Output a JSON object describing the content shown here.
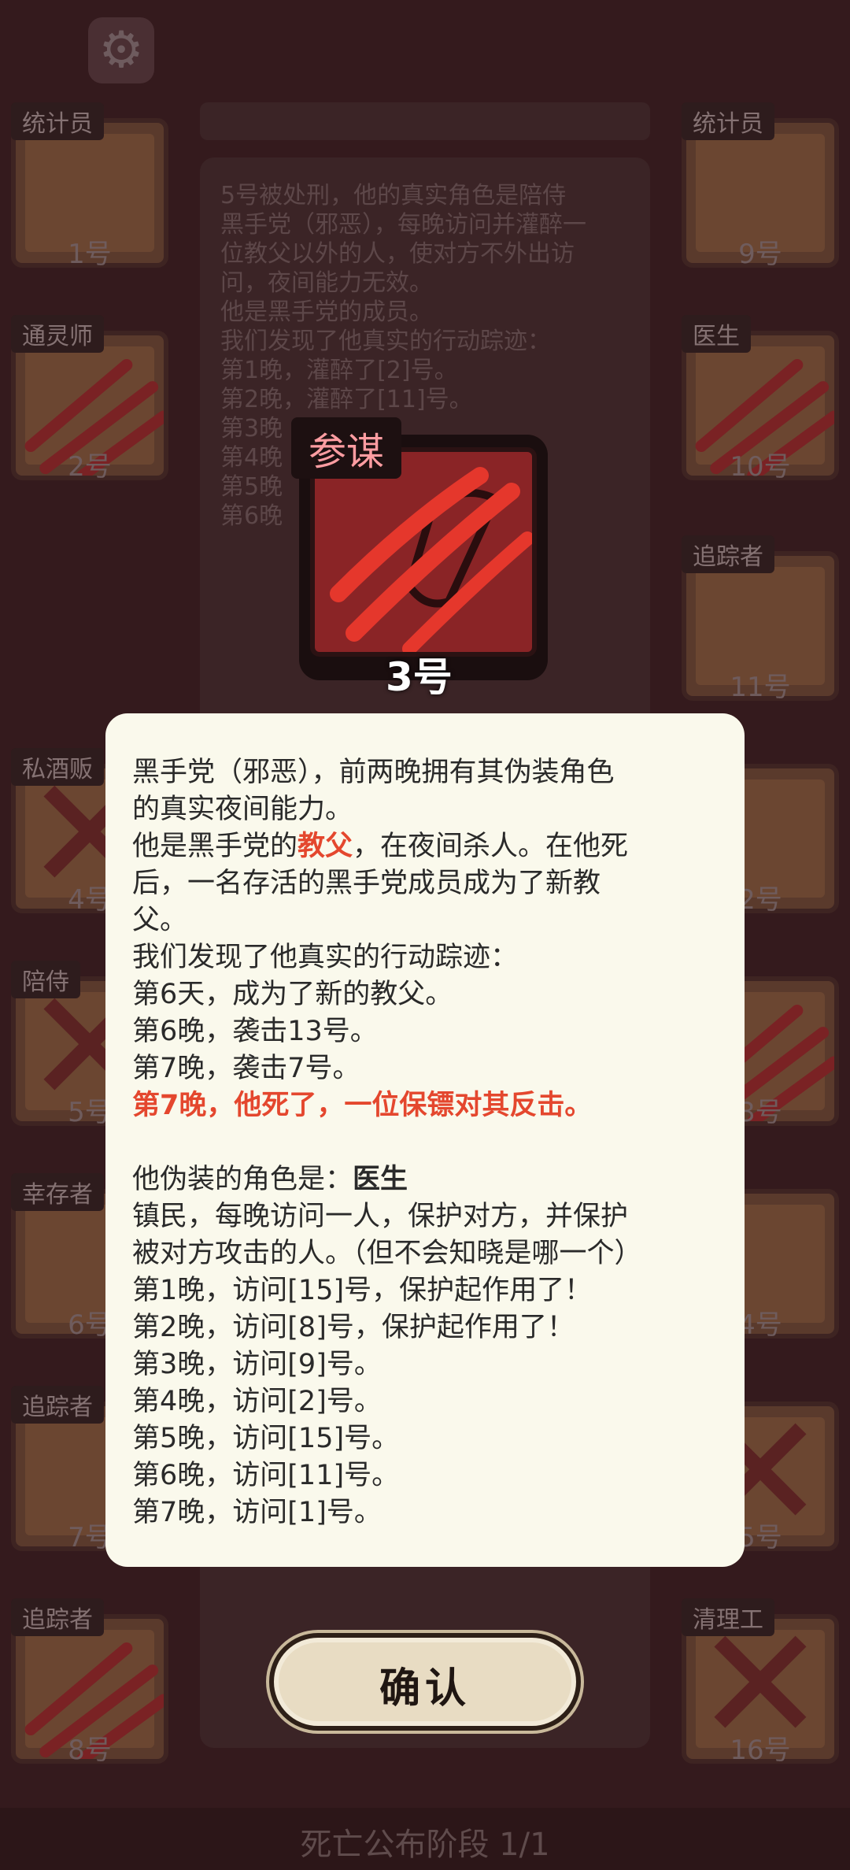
{
  "background": {
    "log_lines": [
      "5号被处刑，他的真实角色是陪侍",
      "黑手党（邪恶），每晚访问并灌醉一",
      "位教父以外的人，使对方不外出访",
      "问，夜间能力无效。",
      "他是黑手党的成员。",
      "我们发现了他真实的行动踪迹：",
      "第1晚，灌醉了[2]号。",
      "第2晚，灌醉了[11]号。",
      "第3晚",
      "第4晚",
      "第5晚",
      "第6晚"
    ],
    "phase_label": "死亡公布阶段 1/1"
  },
  "players": [
    {
      "role": "统计员",
      "number": "1号",
      "status": "alive"
    },
    {
      "role": "通灵师",
      "number": "2号",
      "status": "dead"
    },
    {
      "role": "私酒贩",
      "number": "4号",
      "status": "executed"
    },
    {
      "role": "陪侍",
      "number": "5号",
      "status": "executed"
    },
    {
      "role": "幸存者",
      "number": "6号",
      "status": "alive"
    },
    {
      "role": "追踪者",
      "number": "7号",
      "status": "alive"
    },
    {
      "role": "追踪者",
      "number": "8号",
      "status": "dead"
    },
    {
      "role": "统计员",
      "number": "9号",
      "status": "alive"
    },
    {
      "role": "医生",
      "number": "10号",
      "status": "dead"
    },
    {
      "role": "追踪者",
      "number": "11号",
      "status": "alive"
    },
    {
      "role": "",
      "number": "2号",
      "status": "alive"
    },
    {
      "role": "者",
      "number": "3号",
      "status": "dead"
    },
    {
      "role": "",
      "number": "4号",
      "status": "alive"
    },
    {
      "role": "贩",
      "number": "5号",
      "status": "executed"
    },
    {
      "role": "清理工",
      "number": "16号",
      "status": "executed"
    }
  ],
  "reveal": {
    "role_name": "参谋",
    "player_number": "3号",
    "paragraphs": [
      [
        {
          "t": "黑手党（邪恶），前两晚拥有其伪装角色",
          "s": ""
        }
      ],
      [
        {
          "t": "的真实夜间能力。",
          "s": ""
        }
      ],
      [
        {
          "t": "他是黑手党的",
          "s": ""
        },
        {
          "t": "教父",
          "s": "red"
        },
        {
          "t": "，在夜间杀人。在他死",
          "s": ""
        }
      ],
      [
        {
          "t": "后，一名存活的黑手党成员成为了新教",
          "s": ""
        }
      ],
      [
        {
          "t": "父。",
          "s": ""
        }
      ],
      [
        {
          "t": "我们发现了他真实的行动踪迹：",
          "s": ""
        }
      ],
      [
        {
          "t": "第6天，成为了新的教父。",
          "s": ""
        }
      ],
      [
        {
          "t": "第6晚，袭击13号。",
          "s": ""
        }
      ],
      [
        {
          "t": "第7晚，袭击7号。",
          "s": ""
        }
      ],
      [
        {
          "t": "第7晚，他死了，一位保镖对其反击。",
          "s": "red"
        }
      ],
      [
        {
          "t": "",
          "s": ""
        }
      ],
      [
        {
          "t": "他伪装的角色是：",
          "s": ""
        },
        {
          "t": "医生",
          "s": "bold"
        }
      ],
      [
        {
          "t": "镇民，每晚访问一人，保护对方，并保护",
          "s": ""
        }
      ],
      [
        {
          "t": "被对方攻击的人。（但不会知晓是哪一个）",
          "s": ""
        }
      ],
      [
        {
          "t": "第1晚，访问[15]号，保护起作用了！",
          "s": ""
        }
      ],
      [
        {
          "t": "第2晚，访问[8]号，保护起作用了！",
          "s": ""
        }
      ],
      [
        {
          "t": "第3晚，访问[9]号。",
          "s": ""
        }
      ],
      [
        {
          "t": "第4晚，访问[2]号。",
          "s": ""
        }
      ],
      [
        {
          "t": "第5晚，访问[15]号。",
          "s": ""
        }
      ],
      [
        {
          "t": "第6晚，访问[11]号。",
          "s": ""
        }
      ],
      [
        {
          "t": "第7晚，访问[1]号。",
          "s": ""
        }
      ]
    ]
  },
  "confirm_label": "确认",
  "colors": {
    "accent_red": "#e4472e",
    "dialog_bg": "#faf9ec",
    "role_tag": "#ff9da2"
  }
}
